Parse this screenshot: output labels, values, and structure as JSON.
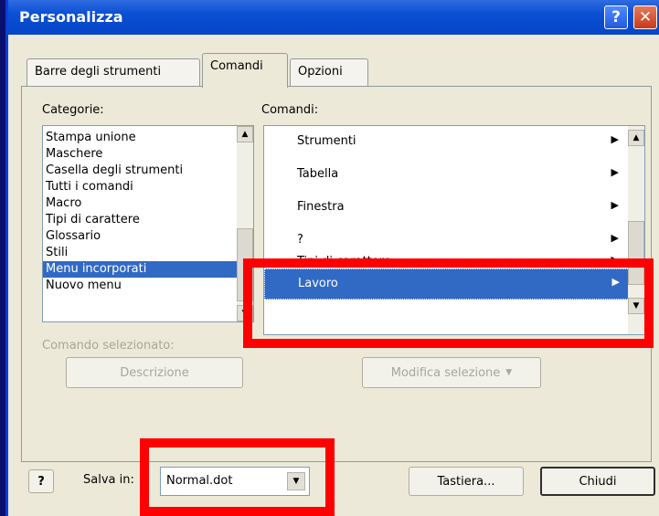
{
  "window": {
    "title": "Personalizza"
  },
  "tabs": [
    {
      "label": "Barre degli strumenti"
    },
    {
      "label": "Comandi"
    },
    {
      "label": "Opzioni"
    }
  ],
  "categories": {
    "label": "Categorie:",
    "items": [
      "Stampa unione",
      "Maschere",
      "Casella degli strumenti",
      "Tutti i comandi",
      "Macro",
      "Tipi di carattere",
      "Glossario",
      "Stili",
      "Menu incorporati",
      "Nuovo menu"
    ],
    "selected": "Menu incorporati"
  },
  "commands": {
    "label": "Comandi:",
    "items": [
      "Strumenti",
      "Tabella",
      "Finestra",
      "?",
      "Tipi di carattere",
      "Lavoro"
    ],
    "selected": "Lavoro"
  },
  "selected_command": {
    "label": "Comando selezionato:",
    "description_button": "Descrizione",
    "modify_button": "Modifica selezione"
  },
  "footer": {
    "help_icon": "?",
    "save_in_label": "Salva in:",
    "save_in_value": "Normal.dot",
    "keyboard_button": "Tastiera...",
    "close_button": "Chiudi"
  },
  "colors": {
    "highlight": "#ff0000",
    "selection": "#316ac5",
    "titlebar": "#0a4fd4"
  }
}
